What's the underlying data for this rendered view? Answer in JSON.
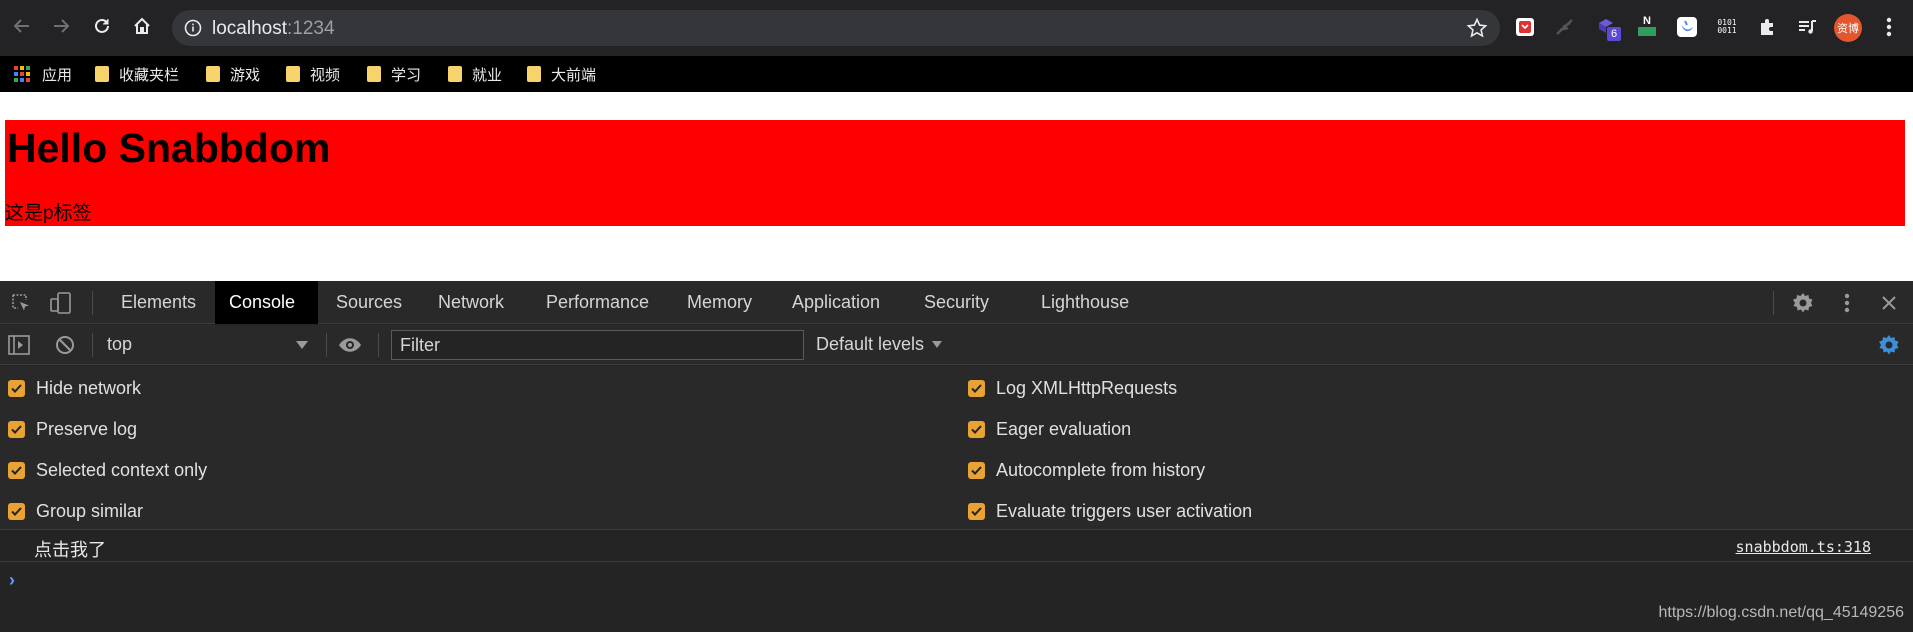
{
  "browser": {
    "url_host": "localhost",
    "url_port": ":1234",
    "extension_badge": "6",
    "ext_binary_label": "0101\n0011",
    "ext_n_label": "N",
    "avatar_label": "资博",
    "bookmarks": [
      {
        "label": "应用"
      },
      {
        "label": "收藏夹栏"
      },
      {
        "label": "游戏"
      },
      {
        "label": "视频"
      },
      {
        "label": "学习"
      },
      {
        "label": "就业"
      },
      {
        "label": "大前端"
      }
    ]
  },
  "page": {
    "heading": "Hello Snabbdom",
    "paragraph": "这是p标签",
    "box_color": "#ff0000"
  },
  "devtools": {
    "tabs": [
      {
        "label": "Elements"
      },
      {
        "label": "Console"
      },
      {
        "label": "Sources"
      },
      {
        "label": "Network"
      },
      {
        "label": "Performance"
      },
      {
        "label": "Memory"
      },
      {
        "label": "Application"
      },
      {
        "label": "Security"
      },
      {
        "label": "Lighthouse"
      }
    ],
    "active_tab": "Console",
    "context": "top",
    "filter_placeholder": "Filter",
    "levels": "Default levels",
    "settings_left": [
      {
        "label": "Hide network",
        "checked": true
      },
      {
        "label": "Preserve log",
        "checked": true
      },
      {
        "label": "Selected context only",
        "checked": true
      },
      {
        "label": "Group similar",
        "checked": true
      }
    ],
    "settings_right": [
      {
        "label": "Log XMLHttpRequests",
        "checked": true
      },
      {
        "label": "Eager evaluation",
        "checked": true
      },
      {
        "label": "Autocomplete from history",
        "checked": true
      },
      {
        "label": "Evaluate triggers user activation",
        "checked": true
      }
    ],
    "log": {
      "message": "点击我了",
      "source": "snabbdom.ts:318"
    },
    "prompt": "›"
  },
  "watermark": "https://blog.csdn.net/qq_45149256",
  "colors": {
    "checkbox": "#e8a334",
    "accent_blue": "#5aa1ff",
    "settings_gear_active": "#3d8fd9"
  }
}
